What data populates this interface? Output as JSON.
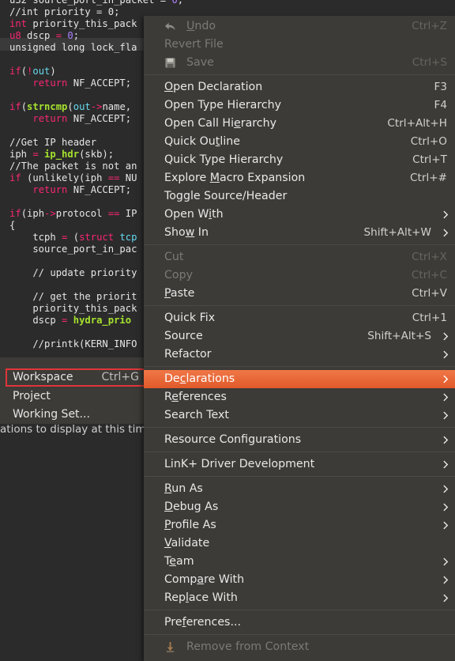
{
  "editor": {
    "lines": [
      {
        "parts": [
          {
            "t": "u32 s",
            "c": "c-plain"
          },
          {
            "t": "ource_port_in_packet",
            "c": "c-plain"
          },
          {
            "t": " = ",
            "c": "c-plain"
          },
          {
            "t": "0",
            "c": "c-num"
          },
          {
            "t": ";",
            "c": "c-plain"
          }
        ]
      },
      {
        "parts": [
          {
            "t": "//int priority = 0;",
            "c": "c-comment"
          }
        ]
      },
      {
        "parts": [
          {
            "t": "int",
            "c": "c-kw"
          },
          {
            "t": " priority_this_pack",
            "c": "c-plain"
          }
        ]
      },
      {
        "parts": [
          {
            "t": "u8",
            "c": "c-kw"
          },
          {
            "t": " dscp ",
            "c": "c-plain"
          },
          {
            "t": "=",
            "c": "c-op"
          },
          {
            "t": " ",
            "c": "c-plain"
          },
          {
            "t": "0",
            "c": "c-num"
          },
          {
            "t": ";",
            "c": "c-plain"
          }
        ]
      },
      {
        "parts": [
          {
            "t": "unsigned long lock_fla",
            "c": "c-plain"
          }
        ]
      },
      {
        "parts": []
      },
      {
        "parts": [
          {
            "t": "if",
            "c": "c-kw"
          },
          {
            "t": "(",
            "c": "c-plain"
          },
          {
            "t": "!",
            "c": "c-op"
          },
          {
            "t": "out",
            "c": "c-type"
          },
          {
            "t": ")",
            "c": "c-plain"
          }
        ]
      },
      {
        "parts": [
          {
            "t": "    ",
            "c": "c-plain"
          },
          {
            "t": "return",
            "c": "c-kw"
          },
          {
            "t": " NF_ACCEPT;",
            "c": "c-plain"
          }
        ]
      },
      {
        "parts": []
      },
      {
        "parts": [
          {
            "t": "if",
            "c": "c-kw"
          },
          {
            "t": "(",
            "c": "c-plain"
          },
          {
            "t": "strncmp",
            "c": "c-fn"
          },
          {
            "t": "(",
            "c": "c-plain"
          },
          {
            "t": "out",
            "c": "c-type"
          },
          {
            "t": "->",
            "c": "c-op"
          },
          {
            "t": "name,",
            "c": "c-plain"
          }
        ]
      },
      {
        "parts": [
          {
            "t": "    ",
            "c": "c-plain"
          },
          {
            "t": "return",
            "c": "c-kw"
          },
          {
            "t": " NF_ACCEPT;",
            "c": "c-plain"
          }
        ]
      },
      {
        "parts": []
      },
      {
        "parts": [
          {
            "t": "//Get IP header",
            "c": "c-comment"
          }
        ]
      },
      {
        "parts": [
          {
            "t": "iph ",
            "c": "c-plain"
          },
          {
            "t": "=",
            "c": "c-op"
          },
          {
            "t": " ",
            "c": "c-plain"
          },
          {
            "t": "ip_hdr",
            "c": "c-fn"
          },
          {
            "t": "(skb);",
            "c": "c-plain"
          }
        ]
      },
      {
        "parts": [
          {
            "t": "//The packet is not an",
            "c": "c-comment"
          }
        ]
      },
      {
        "parts": [
          {
            "t": "if",
            "c": "c-kw"
          },
          {
            "t": " (unlikely(iph ",
            "c": "c-plain"
          },
          {
            "t": "==",
            "c": "c-op"
          },
          {
            "t": " NU",
            "c": "c-plain"
          }
        ]
      },
      {
        "parts": [
          {
            "t": "    ",
            "c": "c-plain"
          },
          {
            "t": "return",
            "c": "c-kw"
          },
          {
            "t": " NF_ACCEPT;",
            "c": "c-plain"
          }
        ]
      },
      {
        "parts": []
      },
      {
        "parts": [
          {
            "t": "if",
            "c": "c-kw"
          },
          {
            "t": "(iph",
            "c": "c-plain"
          },
          {
            "t": "->",
            "c": "c-op"
          },
          {
            "t": "protocol ",
            "c": "c-plain"
          },
          {
            "t": "==",
            "c": "c-op"
          },
          {
            "t": " IP",
            "c": "c-plain"
          }
        ]
      },
      {
        "parts": [
          {
            "t": "{",
            "c": "c-plain"
          }
        ]
      },
      {
        "parts": [
          {
            "t": "    tcph ",
            "c": "c-plain"
          },
          {
            "t": "=",
            "c": "c-op"
          },
          {
            "t": " (",
            "c": "c-plain"
          },
          {
            "t": "struct",
            "c": "c-kw"
          },
          {
            "t": " tcp",
            "c": "c-type"
          }
        ]
      },
      {
        "parts": [
          {
            "t": "    source_port_in_pac",
            "c": "c-plain"
          }
        ]
      },
      {
        "parts": []
      },
      {
        "parts": [
          {
            "t": "    // update priority",
            "c": "c-comment"
          }
        ]
      },
      {
        "parts": []
      },
      {
        "parts": [
          {
            "t": "    // get the priorit",
            "c": "c-comment"
          }
        ]
      },
      {
        "parts": [
          {
            "t": "    priority_this_pack",
            "c": "c-plain"
          }
        ]
      },
      {
        "parts": [
          {
            "t": "    dscp ",
            "c": "c-plain"
          },
          {
            "t": "=",
            "c": "c-op"
          },
          {
            "t": " ",
            "c": "c-plain"
          },
          {
            "t": "hydra_prio",
            "c": "c-fn"
          }
        ]
      },
      {
        "parts": []
      },
      {
        "parts": [
          {
            "t": "    //printk(KERN_INFO",
            "c": "c-comment"
          }
        ]
      }
    ]
  },
  "console": {
    "message": "ations to display at this time."
  },
  "submenu": {
    "items": [
      {
        "label": "Workspace",
        "accel": "Ctrl+G",
        "selected": true
      },
      {
        "label": "Project",
        "accel": "",
        "selected": false
      },
      {
        "label": "Working Set...",
        "accel": "",
        "selected": false
      }
    ]
  },
  "context_menu": {
    "items": [
      {
        "type": "item",
        "label": "Undo",
        "mn": 0,
        "accel": "Ctrl+Z",
        "disabled": true,
        "icon": "undo-icon"
      },
      {
        "type": "item",
        "label": "Revert File",
        "mn": -1,
        "accel": "",
        "disabled": true
      },
      {
        "type": "item",
        "label": "Save",
        "mn": -1,
        "accel": "Ctrl+S",
        "disabled": true,
        "icon": "save-icon"
      },
      {
        "type": "sep"
      },
      {
        "type": "item",
        "label": "Open Declaration",
        "mn": 0,
        "accel": "F3"
      },
      {
        "type": "item",
        "label": "Open Type Hierarchy",
        "mn": -1,
        "accel": "F4"
      },
      {
        "type": "item",
        "label": "Open Call Hierarchy",
        "mn": 12,
        "accel": "Ctrl+Alt+H"
      },
      {
        "type": "item",
        "label": "Quick Outline",
        "mn": 8,
        "accel": "Ctrl+O"
      },
      {
        "type": "item",
        "label": "Quick Type Hierarchy",
        "mn": -1,
        "accel": "Ctrl+T"
      },
      {
        "type": "item",
        "label": "Explore Macro Expansion",
        "mn": 8,
        "accel": "Ctrl+#"
      },
      {
        "type": "item",
        "label": "Toggle Source/Header",
        "mn": -1,
        "accel": ""
      },
      {
        "type": "item",
        "label": "Open With",
        "mn": 6,
        "accel": "",
        "submenu": true
      },
      {
        "type": "item",
        "label": "Show In",
        "mn": 3,
        "accel": "Shift+Alt+W",
        "submenu": true
      },
      {
        "type": "sep"
      },
      {
        "type": "item",
        "label": "Cut",
        "mn": -1,
        "accel": "Ctrl+X",
        "disabled": true
      },
      {
        "type": "item",
        "label": "Copy",
        "mn": -1,
        "accel": "Ctrl+C",
        "disabled": true
      },
      {
        "type": "item",
        "label": "Paste",
        "mn": 0,
        "accel": "Ctrl+V"
      },
      {
        "type": "sep"
      },
      {
        "type": "item",
        "label": "Quick Fix",
        "mn": -1,
        "accel": "Ctrl+1"
      },
      {
        "type": "item",
        "label": "Source",
        "mn": -1,
        "accel": "Shift+Alt+S",
        "submenu": true
      },
      {
        "type": "item",
        "label": "Refactor",
        "mn": -1,
        "accel": "",
        "submenu": true
      },
      {
        "type": "sep"
      },
      {
        "type": "item",
        "label": "Declarations",
        "mn": 2,
        "accel": "",
        "submenu": true,
        "highlight": true
      },
      {
        "type": "item",
        "label": "References",
        "mn": 1,
        "accel": "",
        "submenu": true
      },
      {
        "type": "item",
        "label": "Search Text",
        "mn": -1,
        "accel": "",
        "submenu": true
      },
      {
        "type": "sep"
      },
      {
        "type": "item",
        "label": "Resource Configurations",
        "mn": -1,
        "accel": "",
        "submenu": true
      },
      {
        "type": "sep"
      },
      {
        "type": "item",
        "label": "LinK+ Driver Development",
        "mn": -1,
        "accel": "",
        "submenu": true
      },
      {
        "type": "sep"
      },
      {
        "type": "item",
        "label": "Run As",
        "mn": 0,
        "accel": "",
        "submenu": true
      },
      {
        "type": "item",
        "label": "Debug As",
        "mn": 0,
        "accel": "",
        "submenu": true
      },
      {
        "type": "item",
        "label": "Profile As",
        "mn": 0,
        "accel": "",
        "submenu": true
      },
      {
        "type": "item",
        "label": "Validate",
        "mn": 0,
        "accel": ""
      },
      {
        "type": "item",
        "label": "Team",
        "mn": 1,
        "accel": "",
        "submenu": true
      },
      {
        "type": "item",
        "label": "Compare With",
        "mn": 4,
        "accel": "",
        "submenu": true
      },
      {
        "type": "item",
        "label": "Replace With",
        "mn": 3,
        "accel": "",
        "submenu": true
      },
      {
        "type": "sep"
      },
      {
        "type": "item",
        "label": "Preferences...",
        "mn": 3,
        "accel": ""
      },
      {
        "type": "sep"
      },
      {
        "type": "item",
        "label": "Remove from Context",
        "mn": -1,
        "accel": "",
        "disabled": true,
        "icon": "remove-context-icon"
      }
    ]
  },
  "colors": {
    "menu_bg": "#3c3b37",
    "highlight": "#e86a39",
    "selection_outline": "#e0353a"
  }
}
